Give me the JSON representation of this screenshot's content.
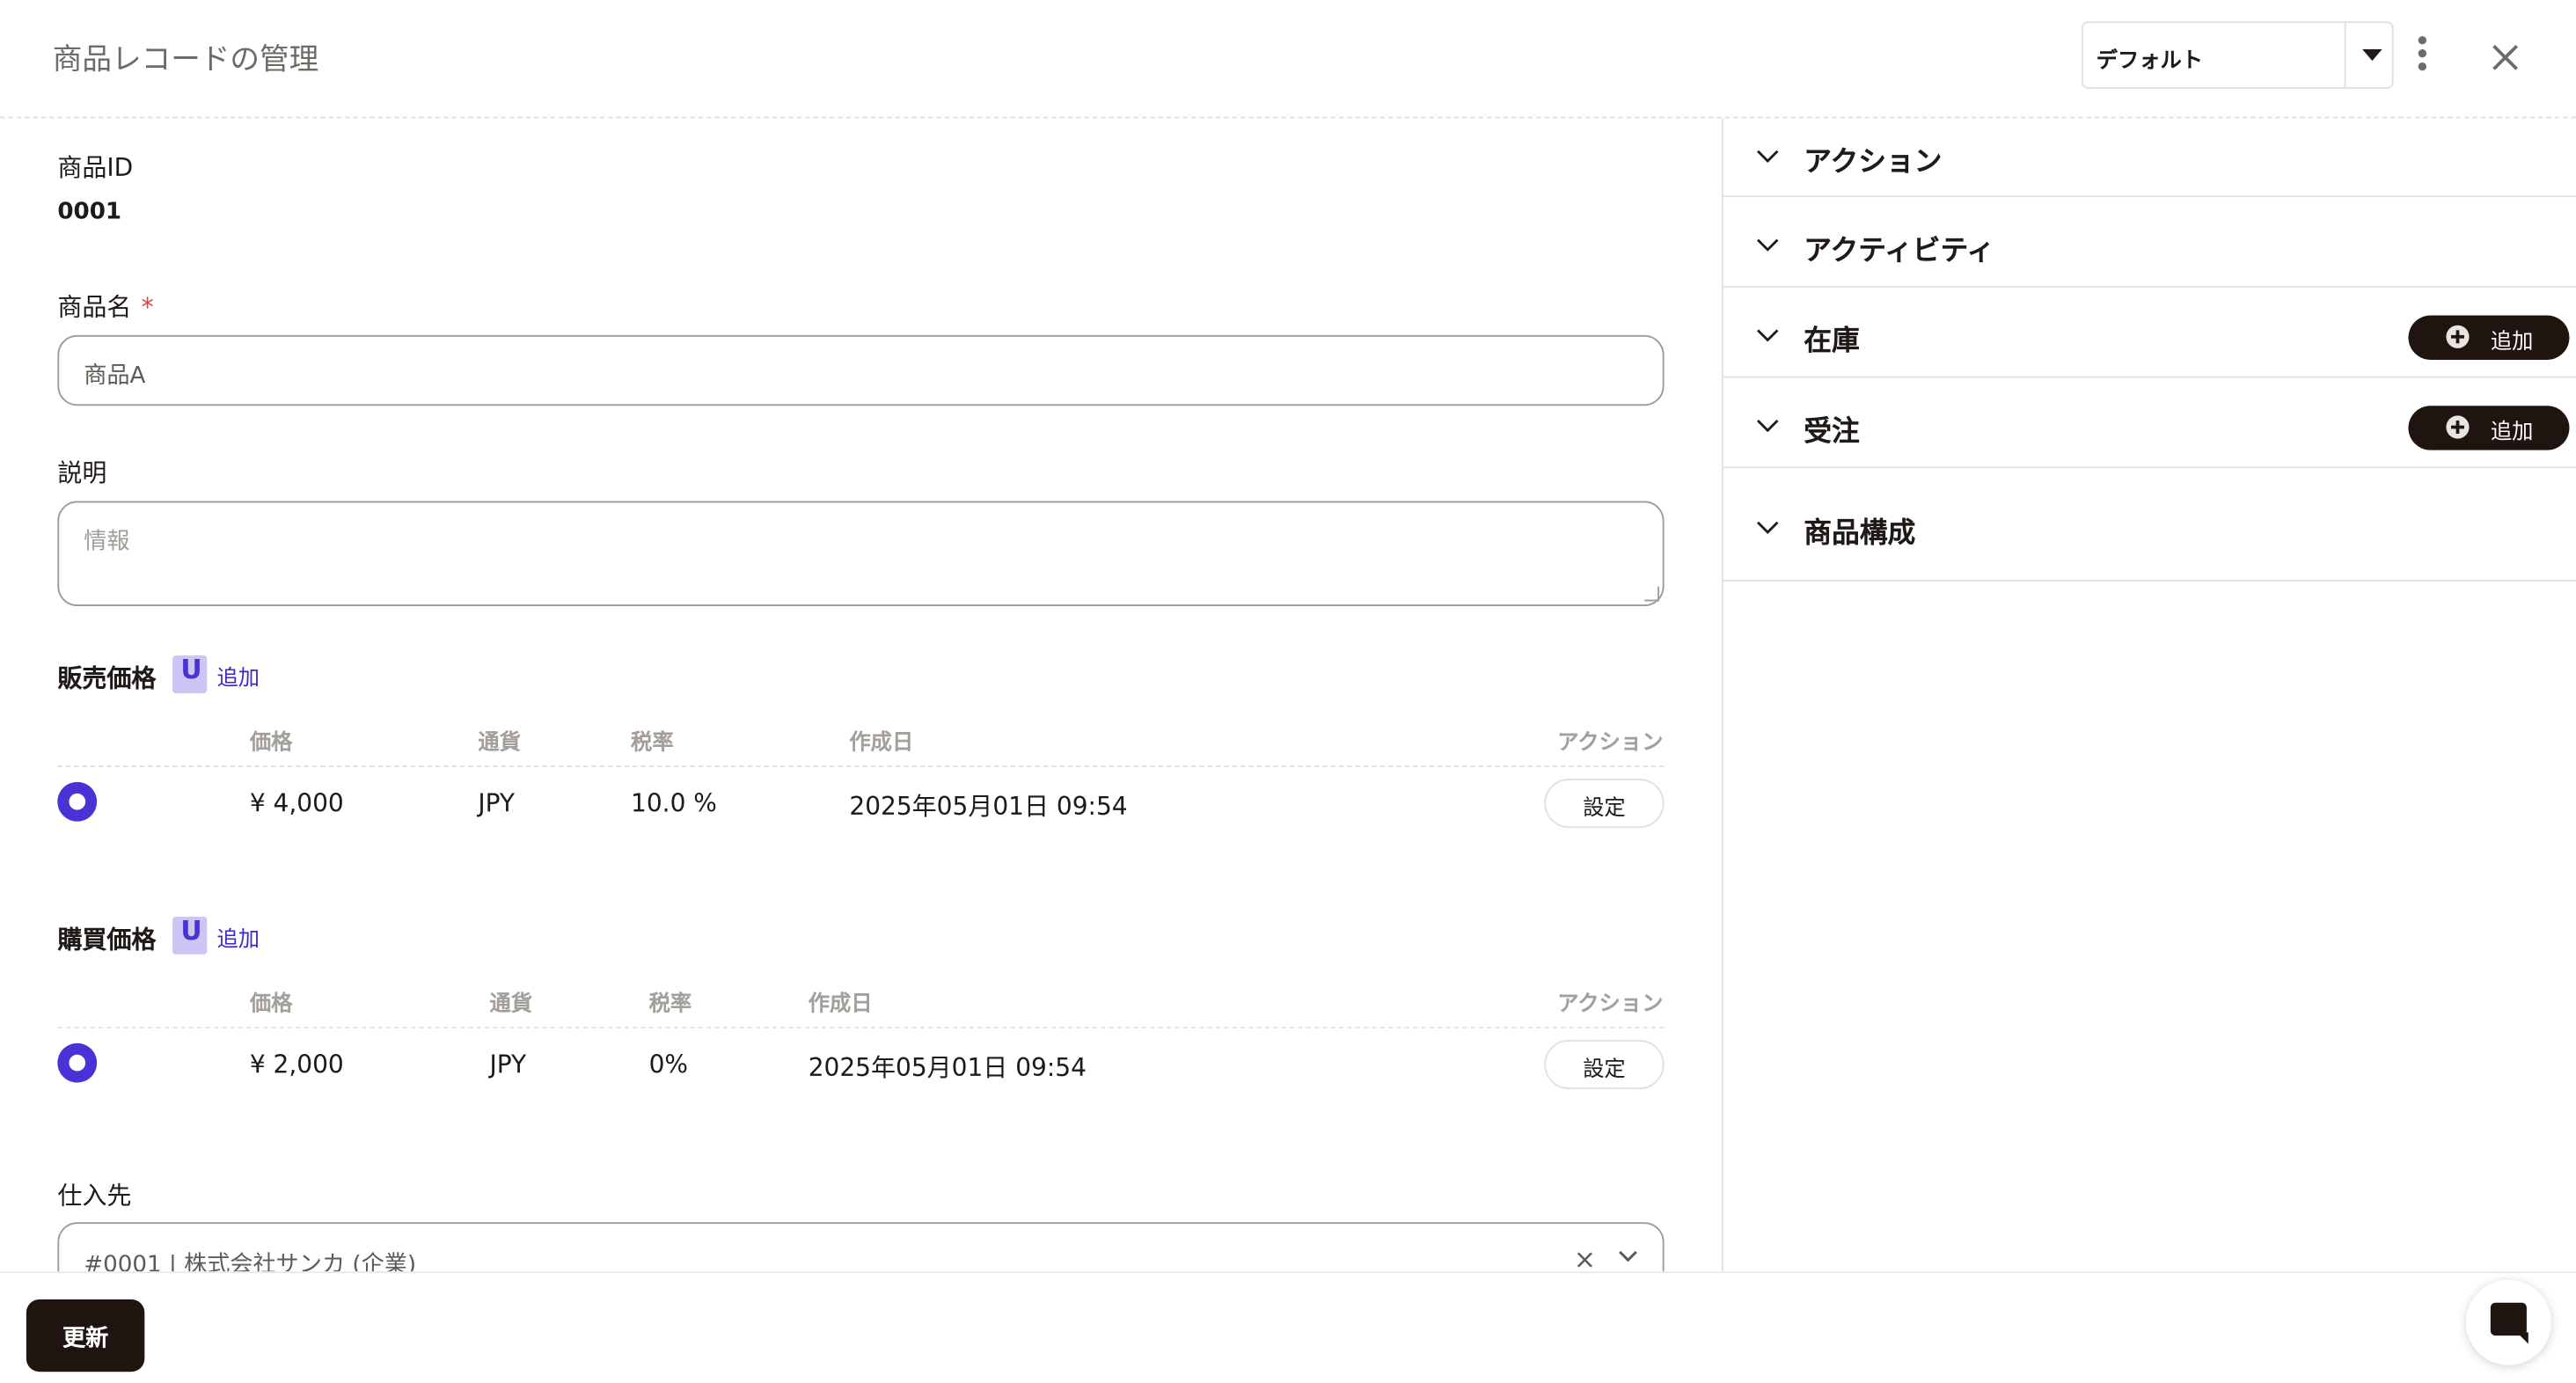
{
  "header": {
    "title": "商品レコードの管理",
    "view_select": "デフォルト"
  },
  "form": {
    "product_id": {
      "label": "商品ID",
      "value": "0001"
    },
    "product_name": {
      "label": "商品名",
      "required_mark": "*",
      "value": "商品A"
    },
    "description": {
      "label": "説明",
      "placeholder": "情報"
    },
    "sales_price": {
      "label": "販売価格",
      "badge": "U",
      "add_label": "追加",
      "columns": [
        "価格",
        "通貨",
        "税率",
        "作成日",
        "アクション"
      ],
      "rows": [
        {
          "price": "¥ 4,000",
          "currency": "JPY",
          "tax": "10.0 %",
          "created": "2025年05月01日 09:54",
          "action": "設定"
        }
      ]
    },
    "purchase_price": {
      "label": "購買価格",
      "badge": "U",
      "add_label": "追加",
      "columns": [
        "価格",
        "通貨",
        "税率",
        "作成日",
        "アクション"
      ],
      "rows": [
        {
          "price": "¥ 2,000",
          "currency": "JPY",
          "tax": "0%",
          "created": "2025年05月01日 09:54",
          "action": "設定"
        }
      ]
    },
    "supplier": {
      "label": "仕入先",
      "value": "#0001 | 株式会社サンカ (企業)",
      "clear_icon": "×"
    }
  },
  "panel": {
    "sections": [
      {
        "label": "アクション"
      },
      {
        "label": "アクティビティ"
      },
      {
        "label": "在庫",
        "add_label": "追加"
      },
      {
        "label": "受注",
        "add_label": "追加"
      },
      {
        "label": "商品構成"
      }
    ]
  },
  "footer": {
    "update_label": "更新"
  },
  "colors": {
    "accent": "#4a33d6",
    "dark_button": "#1f1410",
    "required": "#d8403c"
  }
}
